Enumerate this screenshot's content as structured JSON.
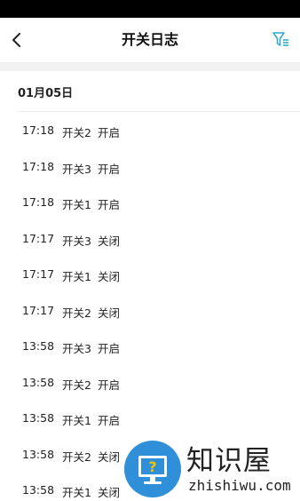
{
  "header": {
    "title": "开关日志",
    "back_icon": "chevron-left-icon",
    "filter_icon": "filter-icon"
  },
  "colors": {
    "accent": "#33aacc",
    "divider": "#ececec",
    "background_gap": "#f2f2f2",
    "watermark_badge": "#2f8fd8"
  },
  "date_group": {
    "date": "01月05日"
  },
  "logs": [
    {
      "time": "17:18",
      "switch": "开关2",
      "state": "开启"
    },
    {
      "time": "17:18",
      "switch": "开关3",
      "state": "开启"
    },
    {
      "time": "17:18",
      "switch": "开关1",
      "state": "开启"
    },
    {
      "time": "17:17",
      "switch": "开关3",
      "state": "关闭"
    },
    {
      "time": "17:17",
      "switch": "开关1",
      "state": "关闭"
    },
    {
      "time": "17:17",
      "switch": "开关2",
      "state": "关闭"
    },
    {
      "time": "13:58",
      "switch": "开关3",
      "state": "开启"
    },
    {
      "time": "13:58",
      "switch": "开关2",
      "state": "开启"
    },
    {
      "time": "13:58",
      "switch": "开关1",
      "state": "开启"
    },
    {
      "time": "13:58",
      "switch": "开关2",
      "state": "关闭"
    },
    {
      "time": "13:58",
      "switch": "开关1",
      "state": "关闭"
    }
  ],
  "watermark": {
    "brand": "知识屋",
    "domain": "zhishiwu.com"
  }
}
